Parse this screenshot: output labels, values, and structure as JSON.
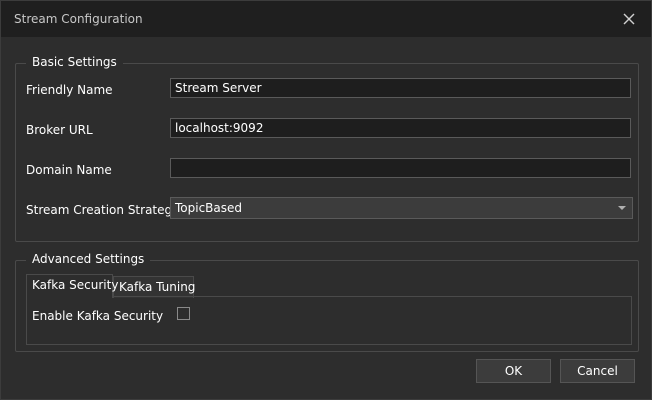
{
  "window": {
    "title": "Stream Configuration",
    "close_icon": "close-icon"
  },
  "basic_settings": {
    "legend": "Basic Settings",
    "friendly_name": {
      "label": "Friendly Name",
      "value": "Stream Server"
    },
    "broker_url": {
      "label": "Broker URL",
      "value": "localhost:9092"
    },
    "domain_name": {
      "label": "Domain Name",
      "value": ""
    },
    "stream_creation_strategy": {
      "label": "Stream Creation Strategy",
      "value": "TopicBased"
    }
  },
  "advanced_settings": {
    "legend": "Advanced Settings",
    "tabs": [
      {
        "label": "Kafka Security",
        "selected": true
      },
      {
        "label": "Kafka Tuning",
        "selected": false
      }
    ],
    "kafka_security": {
      "enable_label": "Enable Kafka Security",
      "enabled": false
    }
  },
  "buttons": {
    "ok": "OK",
    "cancel": "Cancel"
  },
  "colors": {
    "background": "#2d2d2d",
    "titlebar": "#1f1f1f",
    "border": "#4a4a4a",
    "input_background": "#1e1e1e",
    "button_background": "#3c3c3c"
  }
}
